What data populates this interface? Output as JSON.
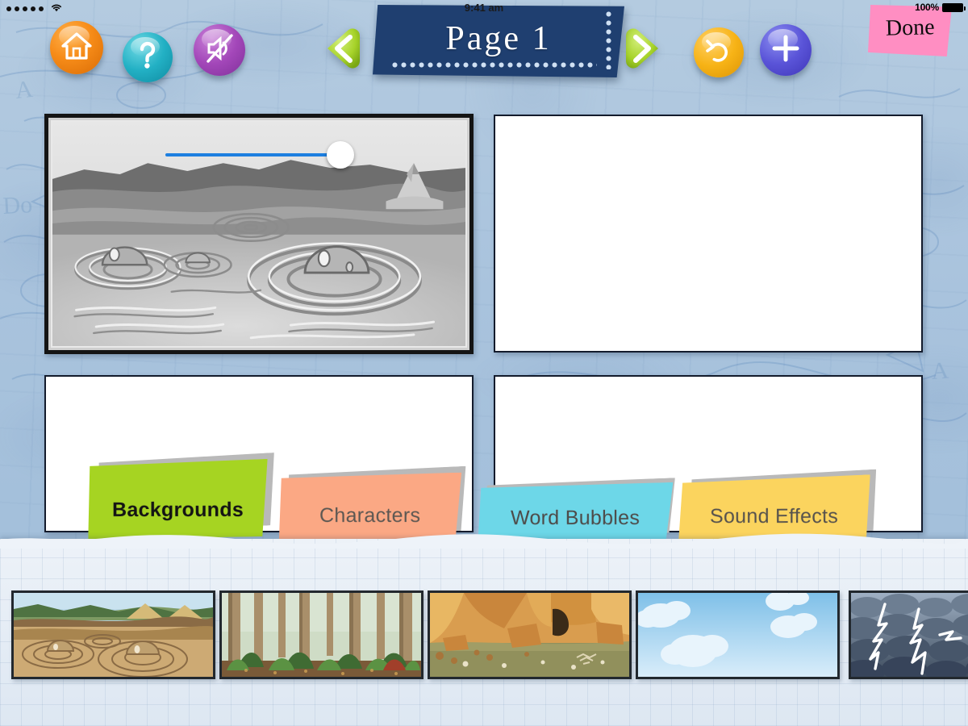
{
  "statusbar": {
    "signal_dots": 5,
    "wifi_icon": "wifi-icon",
    "time": "9:41 am",
    "battery_percent": "100%",
    "battery_icon": "battery-full-icon"
  },
  "toolbar": {
    "home_button": {
      "name": "home-button",
      "icon": "home-icon",
      "color": "#f68b18"
    },
    "help_button": {
      "name": "help-button",
      "icon": "question-mark-icon",
      "color": "#22b0c4"
    },
    "mute_button": {
      "name": "mute-button",
      "icon": "sound-muted-icon",
      "color": "#a347b9"
    },
    "prev_button": {
      "name": "previous-page-button",
      "icon": "chevron-left-icon",
      "color": "#a6d422"
    },
    "next_button": {
      "name": "next-page-button",
      "icon": "chevron-right-icon",
      "color": "#a6d422"
    },
    "undo_button": {
      "name": "undo-button",
      "icon": "undo-arrow-icon",
      "color": "#f7b316"
    },
    "add_button": {
      "name": "add-page-button",
      "icon": "plus-icon",
      "color": "#5a54d8"
    },
    "done_label": "Done",
    "page_title": "Page 1"
  },
  "panels": [
    {
      "index": 1,
      "state": "filled",
      "background_name": "mud-pit-grayscale",
      "selected": true,
      "slider": {
        "name": "opacity-slider",
        "value_percent": 67,
        "track_color": "#1d7fe0"
      }
    },
    {
      "index": 2,
      "state": "empty",
      "background_name": "",
      "selected": false
    },
    {
      "index": 3,
      "state": "empty",
      "background_name": "",
      "selected": false
    },
    {
      "index": 4,
      "state": "empty",
      "background_name": "",
      "selected": false
    }
  ],
  "tabs": [
    {
      "label": "Backgrounds",
      "color": "#a6d422",
      "active": true
    },
    {
      "label": "Characters",
      "color": "#fba884",
      "active": false
    },
    {
      "label": "Word Bubbles",
      "color": "#6dd7e8",
      "active": false
    },
    {
      "label": "Sound Effects",
      "color": "#fbd45e",
      "active": false
    }
  ],
  "library": {
    "category": "Backgrounds",
    "items": [
      {
        "name": "mud-pit-background",
        "clipped": false
      },
      {
        "name": "forest-background",
        "clipped": false
      },
      {
        "name": "cave-background",
        "clipped": false
      },
      {
        "name": "blue-sky-background",
        "clipped": false
      },
      {
        "name": "storm-clouds-background",
        "clipped": true
      }
    ]
  }
}
